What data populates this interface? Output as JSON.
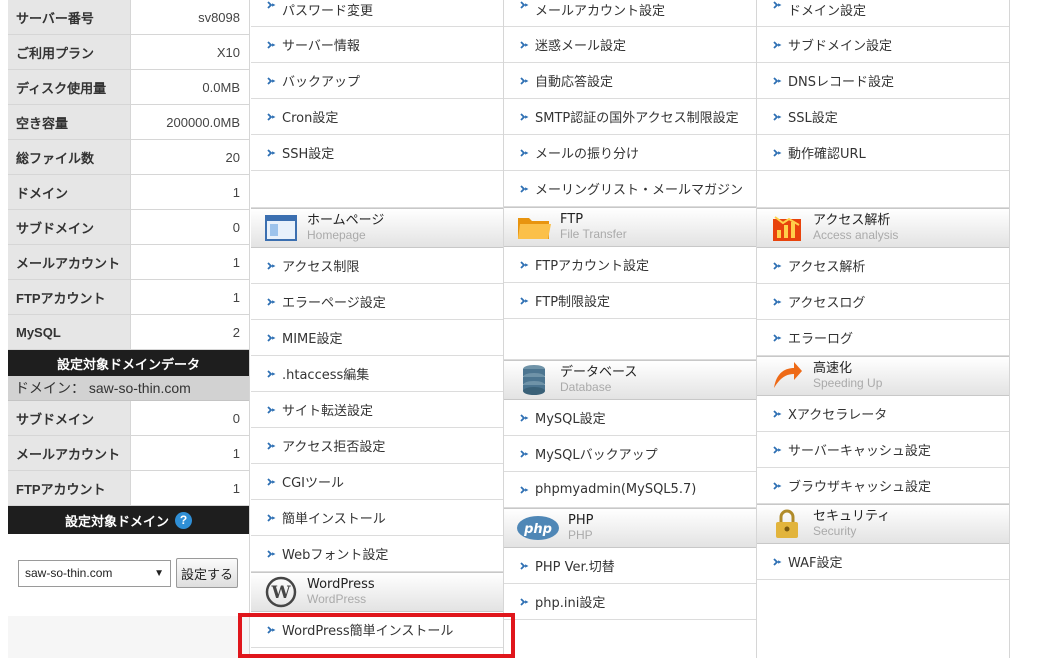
{
  "server_info": [
    {
      "label": "サーバー番号",
      "value": "sv8098"
    },
    {
      "label": "ご利用プラン",
      "value": "X10"
    },
    {
      "label": "ディスク使用量",
      "value": "0.0MB"
    },
    {
      "label": "空き容量",
      "value": "200000.0MB"
    },
    {
      "label": "総ファイル数",
      "value": "20"
    },
    {
      "label": "ドメイン",
      "value": "1"
    },
    {
      "label": "サブドメイン",
      "value": "0"
    },
    {
      "label": "メールアカウント",
      "value": "1"
    },
    {
      "label": "FTPアカウント",
      "value": "1"
    },
    {
      "label": "MySQL",
      "value": "2"
    }
  ],
  "domain_data": {
    "header": "設定対象ドメインデータ",
    "domain_line": "ドメイン： saw-so-thin.com",
    "rows": [
      {
        "label": "サブドメイン",
        "value": "0"
      },
      {
        "label": "メールアカウント",
        "value": "1"
      },
      {
        "label": "FTPアカウント",
        "value": "1"
      }
    ]
  },
  "target_domain": {
    "header": "設定対象ドメイン",
    "help_icon": "?",
    "selected": "saw-so-thin.com",
    "button": "設定する"
  },
  "col1": {
    "top_items": [
      "パスワード変更",
      "サーバー情報",
      "バックアップ",
      "Cron設定",
      "SSH設定"
    ],
    "homepage": {
      "jp": "ホームページ",
      "en": "Homepage",
      "icon": "homepage-window-icon",
      "items": [
        "アクセス制限",
        "エラーページ設定",
        "MIME設定",
        ".htaccess編集",
        "サイト転送設定",
        "アクセス拒否設定",
        "CGIツール",
        "簡単インストール",
        "Webフォント設定"
      ]
    },
    "wordpress": {
      "jp": "WordPress",
      "en": "WordPress",
      "icon": "wordpress-logo-icon",
      "items": [
        "WordPress簡単インストール"
      ]
    }
  },
  "col2": {
    "top_items": [
      "メールアカウント設定",
      "迷惑メール設定",
      "自動応答設定",
      "SMTP認証の国外アクセス制限設定",
      "メールの振り分け",
      "メーリングリスト・メールマガジン"
    ],
    "ftp": {
      "jp": "FTP",
      "en": "File Transfer",
      "icon": "folder-icon",
      "items": [
        "FTPアカウント設定",
        "FTP制限設定"
      ]
    },
    "database": {
      "jp": "データベース",
      "en": "Database",
      "icon": "database-icon",
      "items": [
        "MySQL設定",
        "MySQLバックアップ",
        "phpmyadmin(MySQL5.7)"
      ]
    },
    "php": {
      "jp": "PHP",
      "en": "PHP",
      "icon": "php-logo-icon",
      "logo_text": "php",
      "items": [
        "PHP Ver.切替",
        "php.ini設定"
      ]
    }
  },
  "col3": {
    "top_items": [
      "ドメイン設定",
      "サブドメイン設定",
      "DNSレコード設定",
      "SSL設定",
      "動作確認URL"
    ],
    "access": {
      "jp": "アクセス解析",
      "en": "Access analysis",
      "icon": "bar-chart-icon",
      "items": [
        "アクセス解析",
        "アクセスログ",
        "エラーログ"
      ]
    },
    "speed": {
      "jp": "高速化",
      "en": "Speeding Up",
      "icon": "speed-arrow-icon",
      "items": [
        "Xアクセラレータ",
        "サーバーキャッシュ設定",
        "ブラウザキャッシュ設定"
      ]
    },
    "security": {
      "jp": "セキュリティ",
      "en": "Security",
      "icon": "padlock-icon",
      "items": [
        "WAF設定"
      ]
    }
  },
  "colors": {
    "highlight": "#e0161c",
    "header_bg": "#1e1e1e",
    "help_blue": "#2f8fd6"
  }
}
